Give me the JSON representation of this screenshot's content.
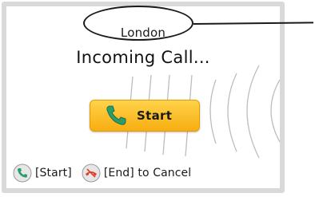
{
  "caller": {
    "name": "London"
  },
  "status": {
    "title": "Incoming Call..."
  },
  "actions": {
    "start_label": "Start"
  },
  "hints": {
    "start_hint": "[Start]",
    "end_hint": "[End] to Cancel"
  },
  "colors": {
    "button_yellow": "#f7ae11",
    "call_green": "#2a9d6a",
    "end_red": "#e0402a",
    "frame_gray": "#d9d9d9"
  },
  "icons": {
    "start_button_icon": "phone-handset-icon",
    "start_key_icon": "green-call-key-icon",
    "end_key_icon": "red-end-call-key-icon"
  }
}
